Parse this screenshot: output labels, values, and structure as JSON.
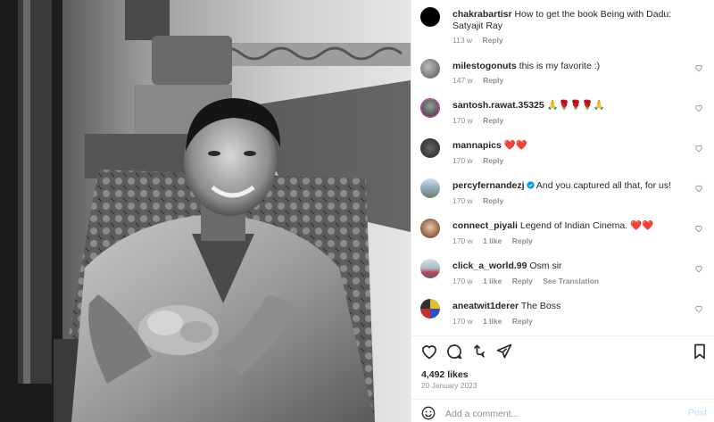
{
  "comments": [
    {
      "user": "chakrabartisr",
      "text": "How to get the book Being with Dadu: Satyajit Ray",
      "time": "113 w",
      "likes": "",
      "reply": "Reply",
      "translation": ""
    },
    {
      "user": "milestogonuts",
      "text": "this is my favorite :)",
      "time": "147 w",
      "likes": "",
      "reply": "Reply",
      "translation": ""
    },
    {
      "user": "santosh.rawat.35325",
      "text": "🙏🌹🌹🌹🙏",
      "time": "170 w",
      "likes": "",
      "reply": "Reply",
      "translation": ""
    },
    {
      "user": "mannapics",
      "text": "❤️❤️",
      "time": "170 w",
      "likes": "",
      "reply": "Reply",
      "translation": ""
    },
    {
      "user": "percyfernandezj",
      "text": "And you captured all that, for us!",
      "time": "170 w",
      "likes": "",
      "reply": "Reply",
      "translation": ""
    },
    {
      "user": "connect_piyali",
      "text": "Legend of Indian Cinema. ❤️❤️",
      "time": "170 w",
      "likes": "1 like",
      "reply": "Reply",
      "translation": ""
    },
    {
      "user": "click_a_world.99",
      "text": "Osm sir",
      "time": "170 w",
      "likes": "1 like",
      "reply": "Reply",
      "translation": "See Translation"
    },
    {
      "user": "aneatwit1derer",
      "text": "The Boss",
      "time": "170 w",
      "likes": "1 like",
      "reply": "Reply",
      "translation": ""
    }
  ],
  "post": {
    "likes": "4,492 likes",
    "date": "20 January 2023"
  },
  "add_comment": {
    "placeholder": "Add a comment...",
    "post_label": "Post"
  },
  "icons": {
    "like": "heart-icon",
    "comment": "comment-icon",
    "share": "share-icon",
    "send": "send-icon",
    "save": "bookmark-icon",
    "emoji": "emoji-icon",
    "verified": "verified-badge-icon"
  },
  "colors": {
    "verified": "#0095f6",
    "post_disabled": "#b2dffc",
    "meta": "#8e8e8e"
  }
}
